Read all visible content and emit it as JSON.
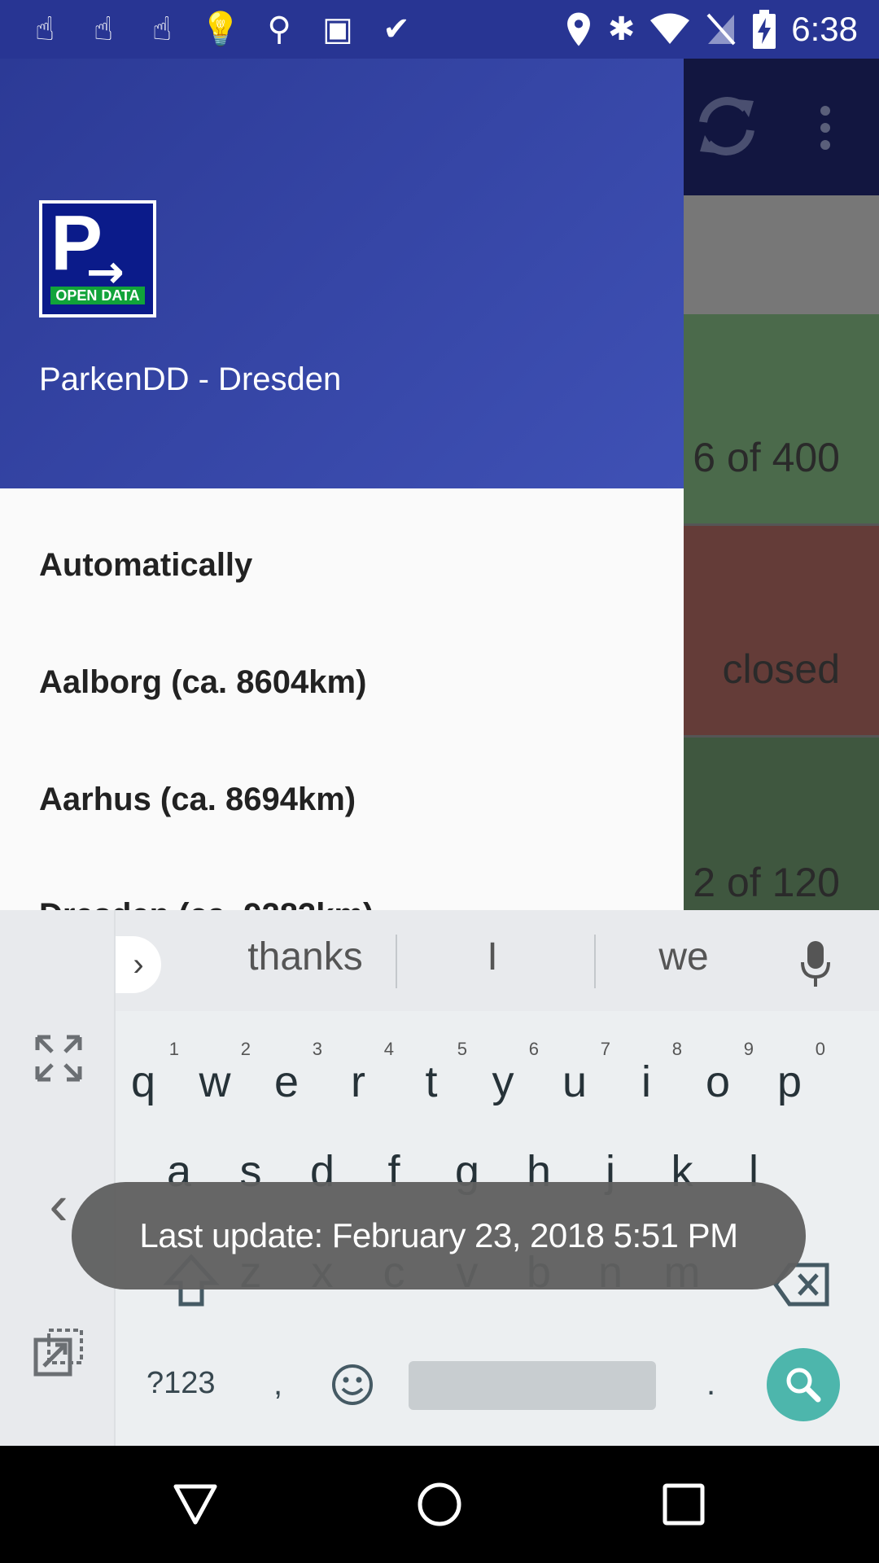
{
  "status_bar": {
    "time": "6:38",
    "left_icons": [
      "hand-pointer-icon",
      "hand-pointer-icon",
      "hand-pointer-icon",
      "lightbulb-icon",
      "keyhole-icon",
      "android-icon",
      "check-icon"
    ],
    "right_icons": [
      "location-icon",
      "bluetooth-icon",
      "wifi-icon",
      "no-sim-icon",
      "battery-charging-icon"
    ]
  },
  "app": {
    "rows": [
      {
        "text": "6 of 400",
        "color": "#4b6a4b"
      },
      {
        "text": "closed",
        "color": "#643c38"
      },
      {
        "text": "2 of 120",
        "color": "#3f573f"
      }
    ]
  },
  "drawer": {
    "logo_text": "OPEN DATA",
    "logo_letter": "P",
    "title": "ParkenDD - Dresden",
    "items": [
      {
        "label": "Automatically"
      },
      {
        "label": "Aalborg (ca. 8604km)"
      },
      {
        "label": "Aarhus (ca. 8694km)"
      },
      {
        "label": "Dresden (ca. 9283km)"
      }
    ]
  },
  "keyboard": {
    "suggestions": [
      "thanks",
      "I",
      "we"
    ],
    "row1": [
      {
        "k": "q",
        "n": "1"
      },
      {
        "k": "w",
        "n": "2"
      },
      {
        "k": "e",
        "n": "3"
      },
      {
        "k": "r",
        "n": "4"
      },
      {
        "k": "t",
        "n": "5"
      },
      {
        "k": "y",
        "n": "6"
      },
      {
        "k": "u",
        "n": "7"
      },
      {
        "k": "i",
        "n": "8"
      },
      {
        "k": "o",
        "n": "9"
      },
      {
        "k": "p",
        "n": "0"
      }
    ],
    "row2": [
      "a",
      "s",
      "d",
      "f",
      "g",
      "h",
      "j",
      "k",
      "l"
    ],
    "row3": [
      "z",
      "x",
      "c",
      "v",
      "b",
      "n",
      "m"
    ],
    "symbols_key": "?123",
    "comma_key": ",",
    "period_key": ".",
    "accent_color": "#4db6ac"
  },
  "toast": {
    "text": "Last update: February 23, 2018 5:51 PM"
  }
}
